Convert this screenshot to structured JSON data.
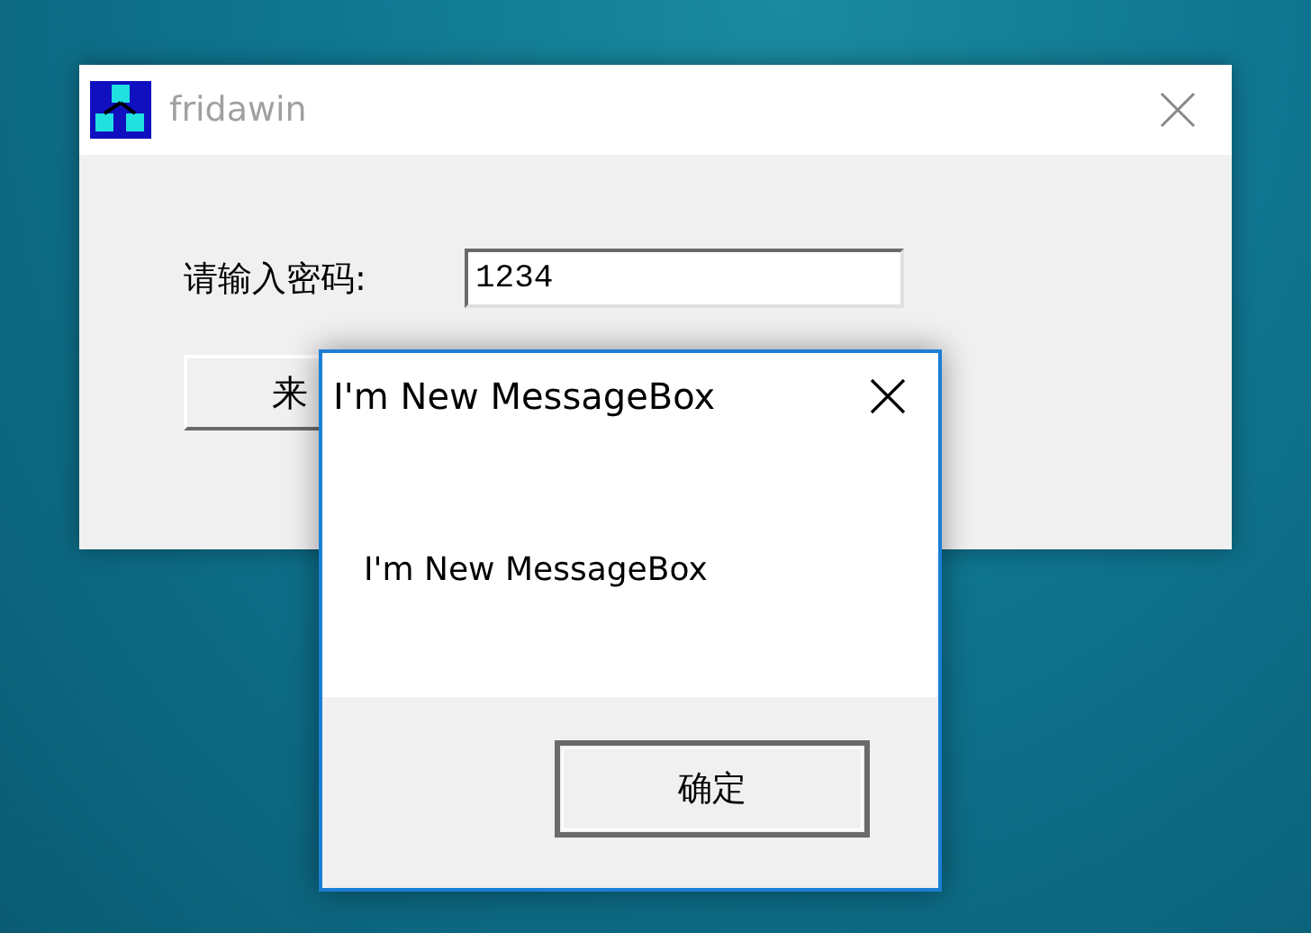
{
  "main_window": {
    "title": "fridawin",
    "password_label": "请输入密码:",
    "password_value": "1234",
    "button_label": "来"
  },
  "message_box": {
    "title": "I'm New MessageBox",
    "message": "I'm New MessageBox",
    "ok_button": "确定"
  }
}
